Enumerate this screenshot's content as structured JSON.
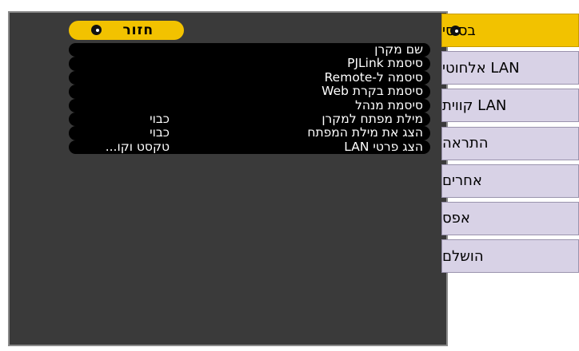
{
  "menu": {
    "back_label": "חזור",
    "rows": [
      {
        "label": "שם מקרן",
        "value": ""
      },
      {
        "label": "סיסמת PJLink",
        "value": ""
      },
      {
        "label": "סיסמה ל-Remote",
        "value": ""
      },
      {
        "label": "סיסמת בקרת Web",
        "value": ""
      },
      {
        "label": "סיסמת מנהל",
        "value": ""
      },
      {
        "label": "מילת מפתח למקרן",
        "value": "כבוי"
      },
      {
        "label": "הצג את מילת המפתח",
        "value": "כבוי"
      },
      {
        "label": "הצג פרטי LAN",
        "value": "טקסט וקו..."
      }
    ]
  },
  "sidebar": {
    "items": [
      {
        "label": "בסיסי",
        "active": true
      },
      {
        "label": "LAN אלחוטי"
      },
      {
        "label": "LAN קווית"
      },
      {
        "label": "התראה"
      },
      {
        "label": "אחרים"
      },
      {
        "label": "אפס"
      },
      {
        "label": "הושלם"
      }
    ]
  },
  "colors": {
    "accent": "#f2c200",
    "panel": "#3a3a3a",
    "row": "#000000",
    "tab": "#d8d2e6"
  },
  "icons": {
    "enter": "enter-icon"
  }
}
